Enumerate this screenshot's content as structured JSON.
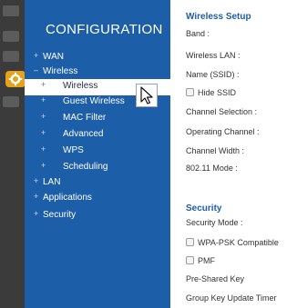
{
  "sidebar": {
    "title": "CONFIGURATION",
    "items": [
      {
        "label": "WAN"
      },
      {
        "label": "Wireless"
      },
      {
        "label": "Wireless",
        "selected": true
      },
      {
        "label": "Guest Wireless"
      },
      {
        "label": "MAC Filter"
      },
      {
        "label": "Advanced"
      },
      {
        "label": "WPS"
      },
      {
        "label": "Scheduling"
      },
      {
        "label": "LAN"
      },
      {
        "label": "Applications"
      },
      {
        "label": "Security"
      }
    ]
  },
  "wireless_setup": {
    "heading": "Wireless Setup",
    "band": "Band :",
    "wireless_lan": "Wireless LAN :",
    "name_ssid": "Name (SSID) :",
    "hide_ssid": "Hide SSID",
    "channel_selection": "Channel Selection :",
    "operating_channel": "Operating Channel :",
    "channel_width": "Channel Width :",
    "mode": "802.11 Mode :"
  },
  "security": {
    "heading": "Security",
    "security_mode": "Security Mode :",
    "wpa_psk_compatible": "WPA-PSK Compatible",
    "pmf": "PMF",
    "pre_shared_key": "Pre-Shared Key",
    "group_key_update_timer": "Group Key Update Timer"
  },
  "colors": {
    "sidebar_bg": "#1c5ea8",
    "heading": "#1c5ea8",
    "selected_bg": "#ffffff",
    "edge_strip": "#3b3b3b",
    "gear_badge": "#e6a21b"
  },
  "icons": {
    "settings": "gear-icon",
    "pointer": "mouse-cursor-icon"
  }
}
